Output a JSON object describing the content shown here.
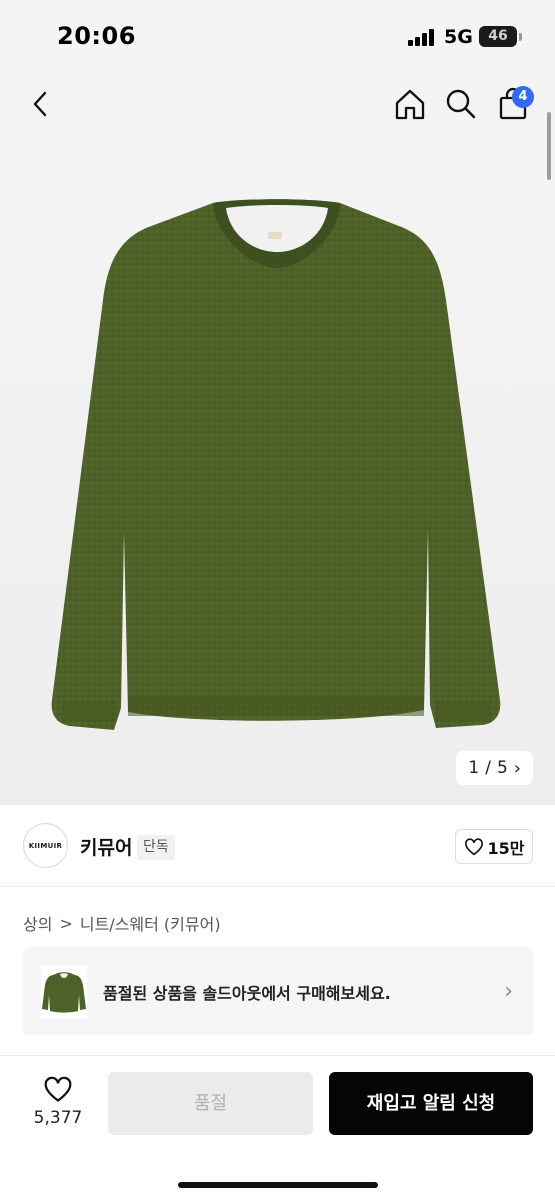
{
  "status_bar": {
    "time": "20:06",
    "network": "5G",
    "battery": "46",
    "battery_level": 0.46
  },
  "nav": {
    "cart_count": "4"
  },
  "gallery": {
    "current": "1",
    "separator": "/",
    "total": "5"
  },
  "brand": {
    "logo_text": "KIIMUIR",
    "name": "키뮤어",
    "badge": "단독",
    "likes": "15만"
  },
  "breadcrumb": {
    "category": "상의",
    "separator": ">",
    "subcategory": "니트/스웨터 (키뮤어)"
  },
  "banner": {
    "text": "품절된 상품을 솔드아웃에서 구매해보세요."
  },
  "bottom": {
    "like_count": "5,377",
    "soldout_label": "품절",
    "restock_label": "재입고 알림 신청"
  },
  "colors": {
    "accent_badge": "#2e6cf6",
    "sweater": "#4d5f27",
    "primary_button": "#050505"
  }
}
